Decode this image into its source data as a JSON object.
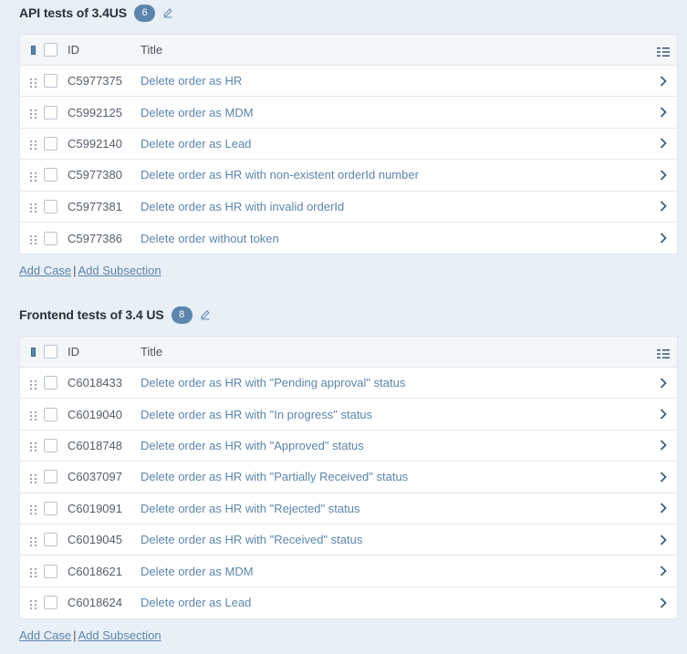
{
  "sections": [
    {
      "title": "API tests of 3.4US",
      "count": "6",
      "header": {
        "id": "ID",
        "title": "Title"
      },
      "rows": [
        {
          "id": "C5977375",
          "title": "Delete order as HR"
        },
        {
          "id": "C5992125",
          "title": "Delete order as MDM"
        },
        {
          "id": "C5992140",
          "title": "Delete order as Lead"
        },
        {
          "id": "C5977380",
          "title": "Delete order as HR with non-existent orderId number"
        },
        {
          "id": "C5977381",
          "title": "Delete order as HR with invalid orderId"
        },
        {
          "id": "C5977386",
          "title": "Delete order without token"
        }
      ],
      "footer": {
        "add_case": "Add Case",
        "separator": "|",
        "add_subsection": "Add Subsection"
      }
    },
    {
      "title": "Frontend tests of 3.4 US",
      "count": "8",
      "header": {
        "id": "ID",
        "title": "Title"
      },
      "rows": [
        {
          "id": "C6018433",
          "title": "Delete order as HR with \"Pending approval\" status"
        },
        {
          "id": "C6019040",
          "title": "Delete order as HR with \"In progress\" status"
        },
        {
          "id": "C6018748",
          "title": "Delete order as HR with \"Approved\" status"
        },
        {
          "id": "C6037097",
          "title": "Delete order as HR with \"Partially Received\" status"
        },
        {
          "id": "C6019091",
          "title": "Delete order as HR with \"Rejected\" status"
        },
        {
          "id": "C6019045",
          "title": "Delete order as HR with \"Received\" status"
        },
        {
          "id": "C6018621",
          "title": "Delete order as MDM"
        },
        {
          "id": "C6018624",
          "title": "Delete order as Lead"
        }
      ],
      "footer": {
        "add_case": "Add Case",
        "separator": "|",
        "add_subsection": "Add Subsection"
      }
    }
  ],
  "icons": {
    "edit": "pencil-icon",
    "drag": "drag-handle-icon",
    "row_open": "chevron-right-icon",
    "columns": "column-list-icon",
    "header_marker": "selection-marker-icon"
  },
  "colors": {
    "link": "#5b85ad",
    "badge": "#5b85ad",
    "background": "#e8eff6"
  }
}
